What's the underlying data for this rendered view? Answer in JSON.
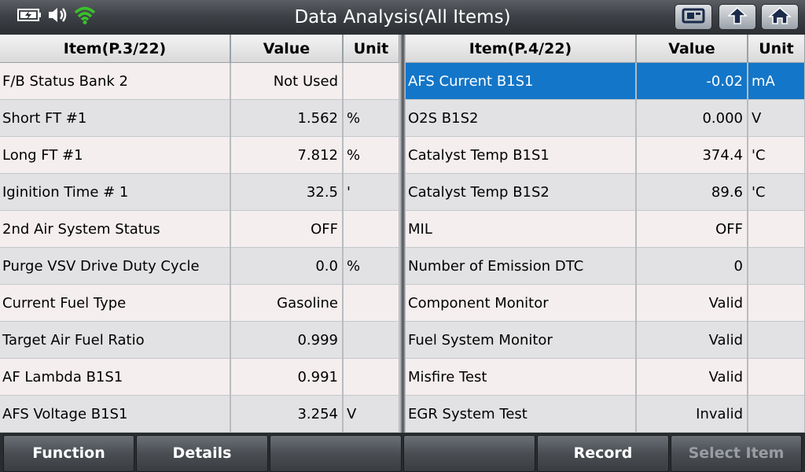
{
  "title": "Data Analysis(All Items)",
  "icons": {
    "battery": "battery-charging-icon",
    "volume": "speaker-icon",
    "wifi": "wifi-icon",
    "window": "window-switch-icon",
    "up": "up-arrow-icon",
    "home": "home-icon"
  },
  "colors": {
    "selected": "#1476c8",
    "wifi": "#39c22b"
  },
  "left_table": {
    "headers": {
      "item": "Item(P.3/22)",
      "value": "Value",
      "unit": "Unit"
    },
    "rows": [
      {
        "item": "F/B Status Bank 2",
        "value": "Not Used",
        "unit": ""
      },
      {
        "item": "Short FT #1",
        "value": "1.562",
        "unit": "%"
      },
      {
        "item": "Long FT #1",
        "value": "7.812",
        "unit": "%"
      },
      {
        "item": "Iginition Time # 1",
        "value": "32.5",
        "unit": "'"
      },
      {
        "item": "2nd Air System Status",
        "value": "OFF",
        "unit": ""
      },
      {
        "item": "Purge VSV Drive Duty Cycle",
        "value": "0.0",
        "unit": "%"
      },
      {
        "item": "Current Fuel Type",
        "value": "Gasoline",
        "unit": ""
      },
      {
        "item": "Target Air Fuel Ratio",
        "value": "0.999",
        "unit": ""
      },
      {
        "item": "AF Lambda B1S1",
        "value": "0.991",
        "unit": ""
      },
      {
        "item": "AFS Voltage B1S1",
        "value": "3.254",
        "unit": "V"
      }
    ]
  },
  "right_table": {
    "headers": {
      "item": "Item(P.4/22)",
      "value": "Value",
      "unit": "Unit"
    },
    "rows": [
      {
        "item": "AFS Current B1S1",
        "value": "-0.02",
        "unit": "mA"
      },
      {
        "item": "O2S B1S2",
        "value": "0.000",
        "unit": "V"
      },
      {
        "item": "Catalyst Temp B1S1",
        "value": "374.4",
        "unit": "'C"
      },
      {
        "item": "Catalyst Temp B1S2",
        "value": "89.6",
        "unit": "'C"
      },
      {
        "item": "MIL",
        "value": "OFF",
        "unit": ""
      },
      {
        "item": "Number of Emission DTC",
        "value": "0",
        "unit": ""
      },
      {
        "item": "Component Monitor",
        "value": "Valid",
        "unit": ""
      },
      {
        "item": "Fuel System Monitor",
        "value": "Valid",
        "unit": ""
      },
      {
        "item": "Misfire Test",
        "value": "Valid",
        "unit": ""
      },
      {
        "item": "EGR System Test",
        "value": "Invalid",
        "unit": ""
      }
    ]
  },
  "bottom_buttons": {
    "function": "Function",
    "details": "Details",
    "empty1": "",
    "empty2": "",
    "record": "Record",
    "select_item": "Select Item"
  }
}
